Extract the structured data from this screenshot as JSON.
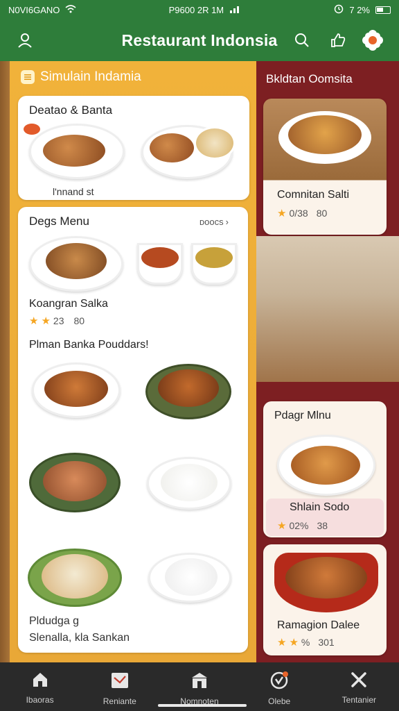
{
  "status": {
    "left": "N0VI6GANO",
    "center": "P9600 2R 1M",
    "right": "7 2%"
  },
  "appbar": {
    "title": "Restaurant Indonsia"
  },
  "left_panel": {
    "header": "Simulain Indamia",
    "card1": {
      "title": "Deatao & Banta",
      "caption": "l'nnand st"
    },
    "card2": {
      "title": "Degs Menu",
      "more": "ᴅoᴏcs",
      "dish_name": "Koangran Salka",
      "rating": "23",
      "count": "80",
      "section_title": "Plman Banka Pouddars!",
      "bottom_line1": "Pldudga g",
      "bottom_line2": "Slenalla, kla Sankan"
    }
  },
  "right_panel": {
    "header": "Bkldtan Oomsita",
    "card1": {
      "name": "Comnitan Salti",
      "rating": "0/38",
      "count": "80"
    },
    "card2": {
      "title": "Pdagr Mlnu",
      "name": "Shlain Sodo",
      "rating": "02%",
      "count": "38"
    },
    "card3": {
      "name": "Ramagion Dalee",
      "rating": "%",
      "count": "301"
    }
  },
  "nav": [
    {
      "label": "Ibaoras",
      "icon": "home-icon"
    },
    {
      "label": "Reniante",
      "icon": "inbox-icon"
    },
    {
      "label": "Nomnoten",
      "icon": "store-icon"
    },
    {
      "label": "Olebe",
      "icon": "offers-icon"
    },
    {
      "label": "Tentanier",
      "icon": "tools-icon"
    }
  ],
  "colors": {
    "green": "#2e7d3a",
    "amber": "#f1b23a",
    "maroon": "#7d1f22",
    "nav": "#2a2a2a"
  }
}
